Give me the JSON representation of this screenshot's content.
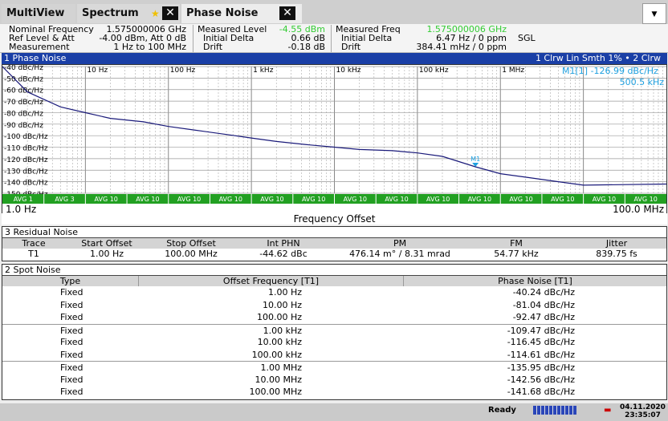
{
  "tabs": {
    "multiview": "MultiView",
    "spectrum": "Spectrum",
    "phase_noise": "Phase Noise",
    "close": "✕"
  },
  "header": {
    "nominal_freq_label": "Nominal Frequency",
    "nominal_freq": "1.575000006 GHz",
    "ref_level_label": "Ref Level & Att",
    "ref_level": "-4.00 dBm, Att 0 dB",
    "measurement_label": "Measurement",
    "measurement": "1 Hz to 100 MHz",
    "meas_level_label": "Measured Level",
    "meas_level": "-4.55 dBm",
    "init_delta_label": "Initial Delta",
    "init_delta_level": "0.66 dB",
    "drift_label": "Drift",
    "drift_level": "-0.18 dB",
    "meas_freq_label": "Measured Freq",
    "meas_freq": "1.575000006 GHz",
    "init_delta_label2": "Initial Delta",
    "init_delta_freq": "6.47 Hz / 0 ppm",
    "drift_label2": "Drift",
    "drift_freq": "384.41 mHz / 0 ppm",
    "sgl": "SGL"
  },
  "phase_window": {
    "title": "1 Phase Noise",
    "traces": "1 Clrw Lin Smth 1% • 2 Clrw",
    "marker_label": "M1[1]",
    "marker_value": "-126.99 dBc/Hz",
    "marker_freq": "500.5 kHz",
    "marker_tag": "M1",
    "start": "1.0 Hz",
    "stop": "100.0 MHz",
    "xlabel": "Frequency Offset"
  },
  "chart_data": {
    "type": "line",
    "xscale": "log",
    "xlim": [
      1,
      100000000
    ],
    "ylim": [
      -150,
      -40
    ],
    "yticks": [
      "-40 dBc/Hz",
      "-50 dBc/Hz",
      "-60 dBc/Hz",
      "-70 dBc/Hz",
      "-80 dBc/Hz",
      "-90 dBc/Hz",
      "-100 dBc/Hz",
      "-110 dBc/Hz",
      "-120 dBc/Hz",
      "-130 dBc/Hz",
      "-140 dBc/Hz",
      "-150 dBc/Hz"
    ],
    "decade_labels": [
      "10 Hz",
      "100 Hz",
      "1 kHz",
      "10 kHz",
      "100 kHz",
      "1 MHz"
    ],
    "avg_labels": [
      "AVG 1",
      "AVG 3",
      "AVG 10",
      "AVG 10",
      "AVG 10",
      "AVG 10",
      "AVG 10",
      "AVG 10",
      "AVG 10",
      "AVG 10",
      "AVG 10",
      "AVG 10",
      "AVG 10",
      "AVG 10",
      "AVG 10",
      "AVG 10"
    ],
    "series": [
      {
        "x": [
          1,
          2,
          5,
          10,
          20,
          50,
          100,
          200,
          500,
          1000,
          2000,
          5000,
          10000,
          20000,
          50000,
          100000,
          200000,
          500000,
          1000000,
          2000000,
          5000000,
          10000000,
          100000000
        ],
        "values": [
          -40,
          -62,
          -75,
          -80,
          -85,
          -88,
          -92,
          -95,
          -99,
          -102,
          -105,
          -108,
          -110,
          -112,
          -113,
          -115,
          -118,
          -127,
          -133,
          -136,
          -140,
          -143,
          -142
        ]
      }
    ]
  },
  "residual": {
    "title": "3 Residual Noise",
    "headers": [
      "Trace",
      "Start Offset",
      "Stop Offset",
      "Int PHN",
      "PM",
      "FM",
      "Jitter"
    ],
    "row": [
      "T1",
      "1.00 Hz",
      "100.00 MHz",
      "-44.62 dBc",
      "476.14 m° / 8.31 mrad",
      "54.77 kHz",
      "839.75 fs"
    ]
  },
  "spot": {
    "title": "2 Spot Noise",
    "headers": [
      "Type",
      "Offset Frequency [T1]",
      "Phase Noise [T1]"
    ],
    "rows": [
      [
        "Fixed",
        "1.00 Hz",
        "-40.24 dBc/Hz"
      ],
      [
        "Fixed",
        "10.00 Hz",
        "-81.04 dBc/Hz"
      ],
      [
        "Fixed",
        "100.00 Hz",
        "-92.47 dBc/Hz"
      ],
      [
        "Fixed",
        "1.00 kHz",
        "-109.47 dBc/Hz"
      ],
      [
        "Fixed",
        "10.00 kHz",
        "-116.45 dBc/Hz"
      ],
      [
        "Fixed",
        "100.00 kHz",
        "-114.61 dBc/Hz"
      ],
      [
        "Fixed",
        "1.00 MHz",
        "-135.95 dBc/Hz"
      ],
      [
        "Fixed",
        "10.00 MHz",
        "-142.56 dBc/Hz"
      ],
      [
        "Fixed",
        "100.00 MHz",
        "-141.68 dBc/Hz"
      ]
    ]
  },
  "status": {
    "ready": "Ready",
    "date": "04.11.2020",
    "time": "23:35:07"
  },
  "colors": {
    "trace": "#1a1a7a",
    "marker": "#1ea0e0",
    "avg_bar": "#22a022",
    "title_bar": "#1a3fa6",
    "green_text": "#33cc33"
  }
}
